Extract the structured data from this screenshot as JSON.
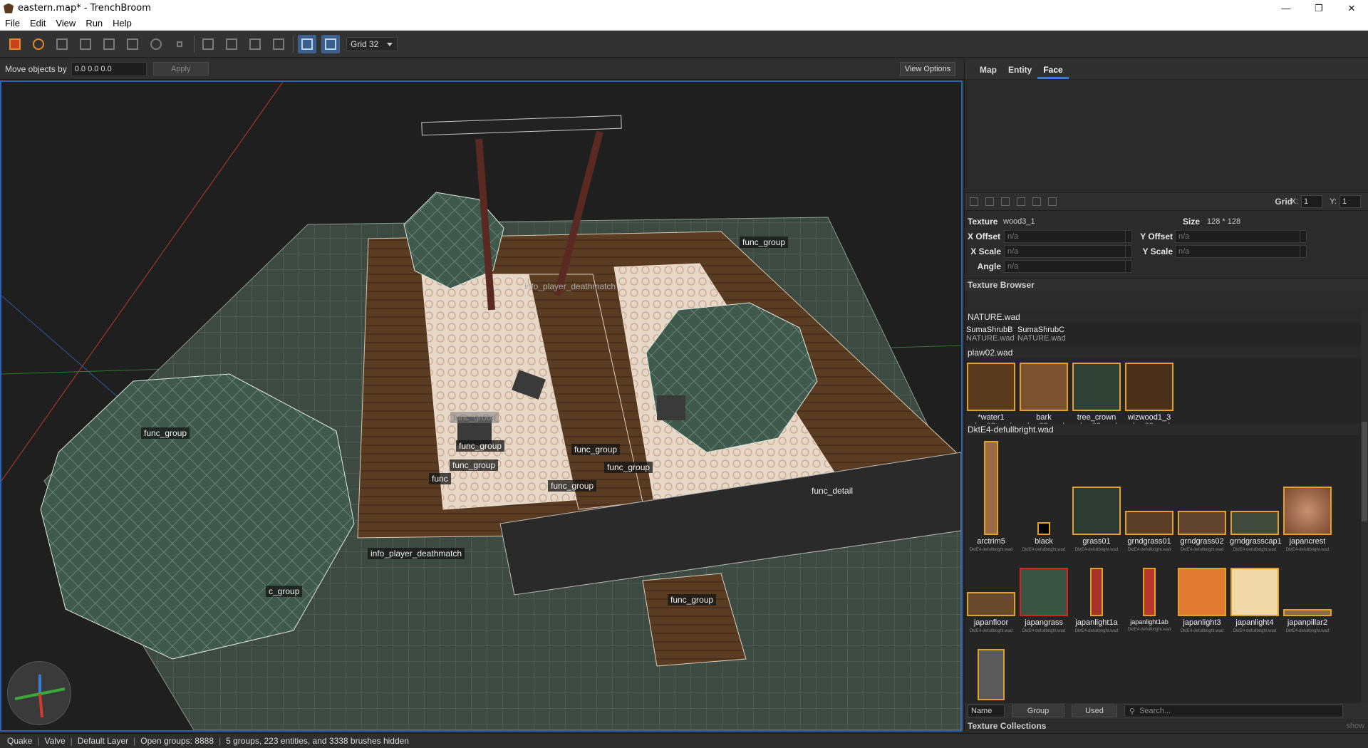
{
  "window": {
    "title": "eastern.map* - TrenchBroom",
    "minimize": "—",
    "maximize": "❐",
    "close": "✕"
  },
  "menu": [
    "File",
    "Edit",
    "View",
    "Run",
    "Help"
  ],
  "toolbar": {
    "grid_select": "Grid 32"
  },
  "move_bar": {
    "label": "Move objects by",
    "value": "0.0 0.0 0.0",
    "apply": "Apply",
    "view_options": "View Options"
  },
  "viewport_labels": [
    {
      "text": "func_group"
    },
    {
      "text": "func_group"
    },
    {
      "text": "info_player_deathmatch"
    },
    {
      "text": "func_group"
    },
    {
      "text": "func_group"
    },
    {
      "text": "func_group"
    },
    {
      "text": "func_group"
    },
    {
      "text": "func_group"
    },
    {
      "text": "func_group"
    },
    {
      "text": "func_detail"
    },
    {
      "text": "info_player_deathmatch"
    },
    {
      "text": "func_group"
    },
    {
      "text": "c_group"
    },
    {
      "text": "func"
    }
  ],
  "right_panel": {
    "tabs": [
      "Map",
      "Entity",
      "Face"
    ],
    "active_tab": "Face",
    "uv_grid_label": "Grid",
    "uv_x_label": "X:",
    "uv_x": "1",
    "uv_y_label": "Y:",
    "uv_y": "1",
    "face": {
      "texture_label": "Texture",
      "texture": "wood3_1",
      "size_label": "Size",
      "size": "128 * 128",
      "x_offset_label": "X Offset",
      "x_offset": "n/a",
      "y_offset_label": "Y Offset",
      "y_offset": "n/a",
      "x_scale_label": "X Scale",
      "x_scale": "n/a",
      "y_scale_label": "Y Scale",
      "y_scale": "n/a",
      "angle_label": "Angle",
      "angle": "n/a"
    },
    "texture_browser_title": "Texture Browser",
    "wads": [
      {
        "name": "NATURE.wad",
        "textures": [
          {
            "name": "SumaShrubB",
            "src": "NATURE.wad"
          },
          {
            "name": "SumaShrubC",
            "src": "NATURE.wad"
          }
        ]
      },
      {
        "name": "plaw02.wad",
        "textures": [
          {
            "name": "*water1",
            "src": "plaw02.wad"
          },
          {
            "name": "bark",
            "src": "plaw02.wad"
          },
          {
            "name": "tree_crown",
            "src": "plaw02.wad"
          },
          {
            "name": "wizwood1_3",
            "src": "plaw02.wad"
          }
        ]
      },
      {
        "name": "DktE4-defullbright.wad",
        "textures": [
          {
            "name": "arctrim5",
            "src": "DktE4-defullbright.wad"
          },
          {
            "name": "black",
            "src": "DktE4-defullbright.wad"
          },
          {
            "name": "grass01",
            "src": "DktE4-defullbright.wad"
          },
          {
            "name": "grndgrass01",
            "src": "DktE4-defullbright.wad"
          },
          {
            "name": "grndgrass02",
            "src": "DktE4-defullbright.wad"
          },
          {
            "name": "grndgrasscap1",
            "src": "DktE4-defullbright.wad"
          },
          {
            "name": "japancrest",
            "src": "DktE4-defullbright.wad"
          },
          {
            "name": "japanfloor",
            "src": "DktE4-defullbright.wad"
          },
          {
            "name": "japangrass",
            "src": "DktE4-defullbright.wad"
          },
          {
            "name": "japanlight1a",
            "src": "DktE4-defullbright.wad"
          },
          {
            "name": "japanlight1ab",
            "src": "DktE4-defullbright.wad"
          },
          {
            "name": "japanlight3",
            "src": "DktE4-defullbright.wad"
          },
          {
            "name": "japanlight4",
            "src": "DktE4-defullbright.wad"
          },
          {
            "name": "japanpillar2",
            "src": "DktE4-defullbright.wad"
          }
        ]
      }
    ],
    "browser_bar": {
      "sort": "Name",
      "group": "Group",
      "used": "Used",
      "search_placeholder": "Search..."
    },
    "collections_title": "Texture Collections",
    "collections_show": "show"
  },
  "status": [
    "Quake",
    "Valve",
    "Default Layer",
    "Open groups: 8888",
    "5 groups, 223 entities, and 3338 brushes hidden"
  ],
  "colors": {
    "accent": "#3a7cd6",
    "texture_border": "#e2a22a",
    "selected_border": "#d22222",
    "viewport_border": "#2a62b8"
  }
}
